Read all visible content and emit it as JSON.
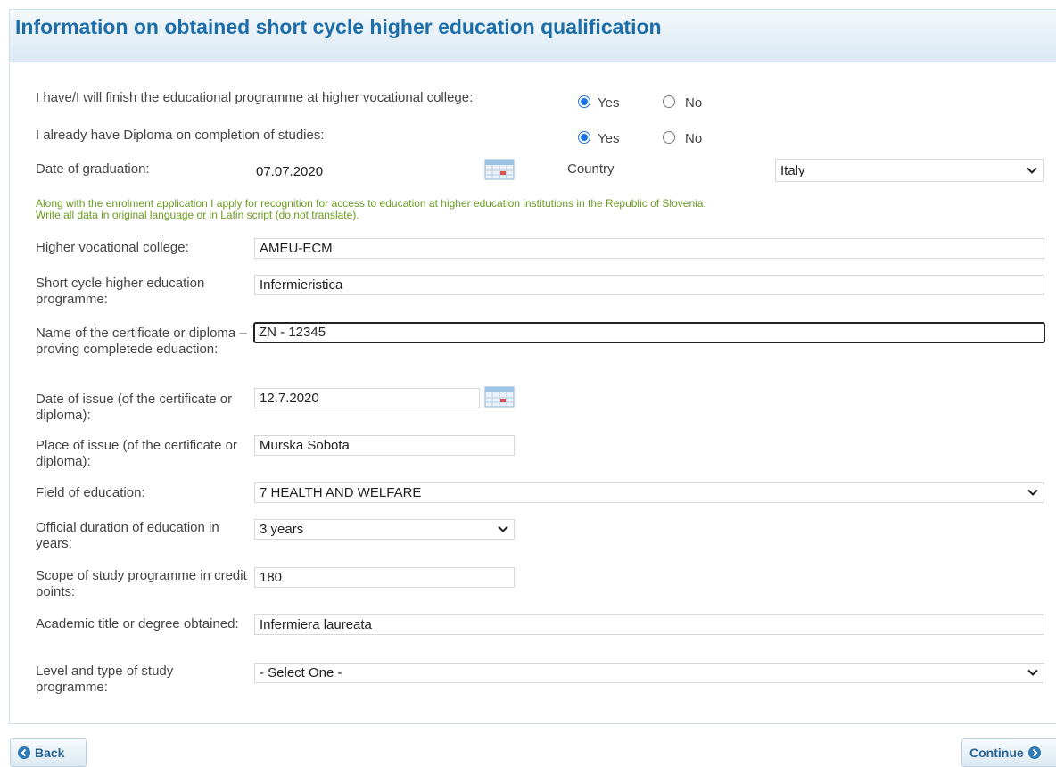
{
  "title": "Information on obtained short cycle higher education qualification",
  "q_college": {
    "label": "I have/I will finish the educational programme at higher vocational college:",
    "yes": "Yes",
    "no": "No",
    "selected": "Yes"
  },
  "q_diploma": {
    "label": "I already have Diploma on completion of studies:",
    "yes": "Yes",
    "no": "No",
    "selected": "Yes"
  },
  "graduation": {
    "label": "Date of graduation:",
    "value": "07.07.2020",
    "country_label": "Country",
    "country_value": "Italy"
  },
  "note": {
    "line1": "Along with the enrolment application I apply for recognition for access to education at higher education institutions in the Republic of Slovenia.",
    "line2": "Write all data in original language or in Latin script (do not translate)."
  },
  "fields": {
    "college": {
      "label": "Higher vocational college:",
      "value": "AMEU-ECM"
    },
    "programme": {
      "label": "Short cycle higher education programme:",
      "value": "Infermieristica"
    },
    "certificate": {
      "label": "Name of the certificate or diploma – proving completede eduaction:",
      "value": "ZN - 12345"
    },
    "issue_date": {
      "label": "Date of issue (of the certificate or diploma):",
      "value": "12.7.2020"
    },
    "issue_place": {
      "label": "Place of issue (of the certificate or diploma):",
      "value": "Murska Sobota"
    },
    "field_of_education": {
      "label": "Field of education:",
      "value": "7 HEALTH AND WELFARE"
    },
    "duration": {
      "label": "Official duration of education in years:",
      "value": "3 years"
    },
    "credits": {
      "label": "Scope of study programme in credit points:",
      "value": "180"
    },
    "academic_title": {
      "label": "Academic title or degree obtained:",
      "value": "Infermiera laureata"
    },
    "level": {
      "label": "Level and type of study programme:",
      "value": "- Select One -"
    }
  },
  "buttons": {
    "back": "Back",
    "continue": "Continue"
  },
  "colors": {
    "title": "#1c6da8",
    "note": "#6a9a1f",
    "radio": "#1a73e8"
  },
  "icons": [
    "calendar-icon",
    "chevron-down-icon",
    "arrow-left-circle-icon",
    "arrow-right-circle-icon"
  ]
}
